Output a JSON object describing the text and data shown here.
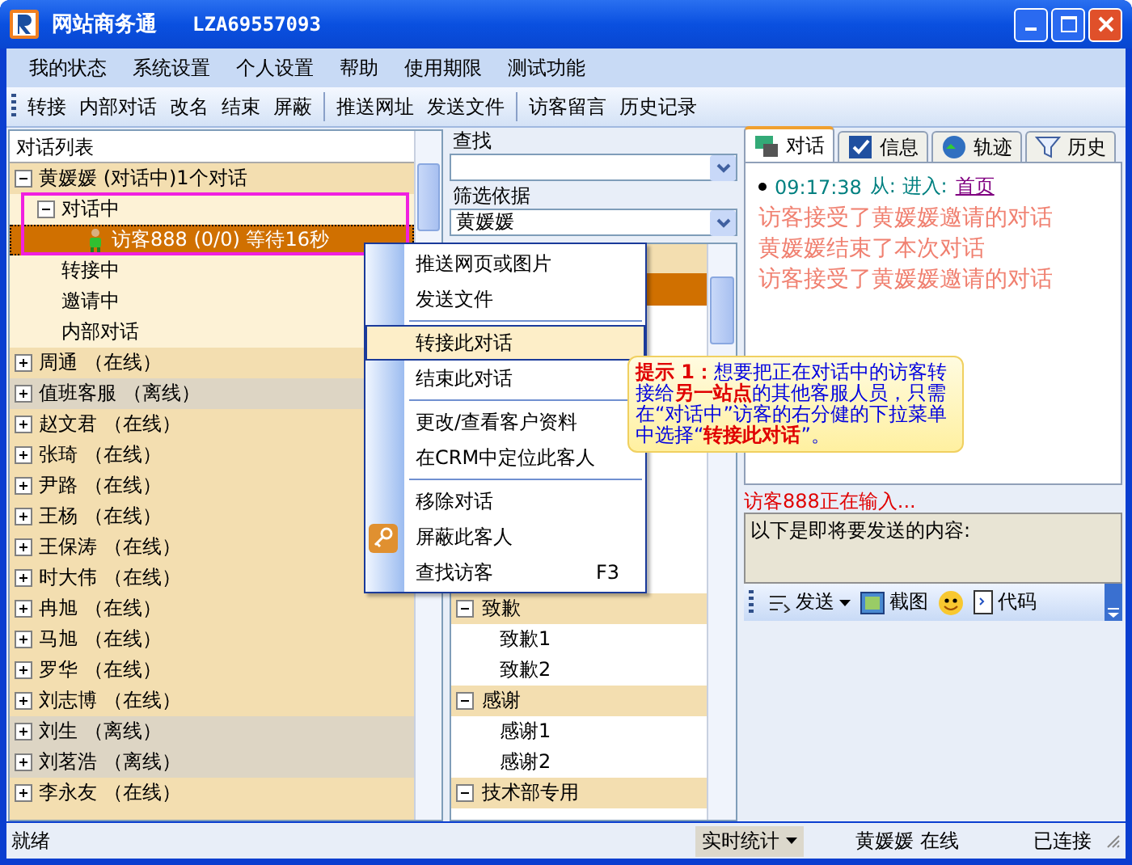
{
  "window": {
    "title": "网站商务通",
    "account": "LZA69557093"
  },
  "menu_bar": [
    "我的状态",
    "系统设置",
    "个人设置",
    "帮助",
    "使用期限",
    "测试功能"
  ],
  "toolbar": [
    [
      "转接",
      "内部对话",
      "改名",
      "结束",
      "屏蔽"
    ],
    [
      "推送网址",
      "发送文件"
    ],
    [
      "访客留言",
      "历史记录"
    ]
  ],
  "conversation_list": {
    "title": "对话列表",
    "tree": [
      {
        "label": "黄媛媛 (对话中)1个对话",
        "online": true,
        "expanded": true,
        "selected": false,
        "children": [
          {
            "label": "对话中",
            "expanded": true,
            "selected": false,
            "children": [
              {
                "label": "访客888 (0/0) 等待16秒",
                "kind": "visitor",
                "selected": true
              }
            ]
          },
          {
            "label": "转接中",
            "selected": false
          },
          {
            "label": "邀请中",
            "selected": false
          },
          {
            "label": "内部对话",
            "selected": false
          }
        ]
      },
      {
        "label": "周通 （在线）",
        "online": true,
        "expanded": false,
        "selected": false
      },
      {
        "label": "值班客服 （离线）",
        "online": false,
        "expanded": false,
        "selected": false
      },
      {
        "label": "赵文君 （在线）",
        "online": true,
        "expanded": false,
        "selected": false
      },
      {
        "label": "张琦 （在线）",
        "online": true,
        "expanded": false,
        "selected": false
      },
      {
        "label": "尹路 （在线）",
        "online": true,
        "expanded": false,
        "selected": false
      },
      {
        "label": "王杨 （在线）",
        "online": true,
        "expanded": false,
        "selected": false
      },
      {
        "label": "王保涛 （在线）",
        "online": true,
        "expanded": false,
        "selected": false
      },
      {
        "label": "时大伟 （在线）",
        "online": true,
        "expanded": false,
        "selected": false
      },
      {
        "label": "冉旭 （在线）",
        "online": true,
        "expanded": false,
        "selected": false
      },
      {
        "label": "马旭 （在线）",
        "online": true,
        "expanded": false,
        "selected": false
      },
      {
        "label": "罗华 （在线）",
        "online": true,
        "expanded": false,
        "selected": false
      },
      {
        "label": "刘志博 （在线）",
        "online": true,
        "expanded": false,
        "selected": false
      },
      {
        "label": "刘生 （离线）",
        "online": false,
        "expanded": false,
        "selected": false
      },
      {
        "label": "刘茗浩 （离线）",
        "online": false,
        "expanded": false,
        "selected": false
      },
      {
        "label": "李永友 （在线）",
        "online": true,
        "expanded": false,
        "selected": false
      }
    ]
  },
  "search": {
    "label": "查找"
  },
  "filter": {
    "label": "筛选依据",
    "value": "黄媛媛"
  },
  "phrases": [
    {
      "label": "致歉",
      "expanded": true,
      "children": [
        "致歉1",
        "致歉2"
      ]
    },
    {
      "label": "感谢",
      "expanded": true,
      "children": [
        "感谢1",
        "感谢2"
      ]
    },
    {
      "label": "技术部专用",
      "expanded": true
    }
  ],
  "context_menu": [
    [
      {
        "label": "推送网页或图片",
        "selected": false
      },
      {
        "label": "发送文件",
        "selected": false
      }
    ],
    [
      {
        "label": "转接此对话",
        "selected": true
      },
      {
        "label": "结束此对话",
        "selected": false
      }
    ],
    [
      {
        "label": "更改/查看客户资料",
        "selected": false
      },
      {
        "label": "在CRM中定位此客人",
        "selected": false
      }
    ],
    [
      {
        "label": "移除对话",
        "selected": false
      },
      {
        "label": "屏蔽此客人",
        "selected": false,
        "kind": "key"
      },
      {
        "label": "查找访客",
        "selected": false,
        "shortcut": "F3"
      }
    ]
  ],
  "tip": "**提示 1：**想要把正在对话中的访客转接给**另一站点**的其他客服人员，只需在“对话中”访客的右分健的下拉菜单中选择“**转接此对话**”。",
  "tabs": [
    {
      "label": "对话",
      "kind": "chat",
      "selected": true
    },
    {
      "label": "信息",
      "kind": "info",
      "selected": false
    },
    {
      "label": "轨迹",
      "kind": "track",
      "selected": false
    },
    {
      "label": "历史",
      "kind": "history",
      "selected": false
    }
  ],
  "chat": {
    "time": "09:17:38",
    "entry": "从: 进入:",
    "link": "首页",
    "messages": [
      "访客接受了黄媛媛邀请的对话",
      "黄媛媛结束了本次对话",
      "访客接受了黄媛媛邀请的对话"
    ]
  },
  "typing": "访客888正在输入...",
  "input": {
    "placeholder": "以下是即将要发送的内容:"
  },
  "input_toolbar": [
    {
      "label": "发送",
      "kind": "send"
    },
    {
      "label": "截图",
      "kind": "capture"
    },
    {
      "kind": "emoji"
    },
    {
      "label": "代码",
      "kind": "code"
    }
  ],
  "status_bar": {
    "status": "就绪",
    "stats": "实时统计",
    "agent": "黄媛媛 在线",
    "connection": "已连接"
  }
}
